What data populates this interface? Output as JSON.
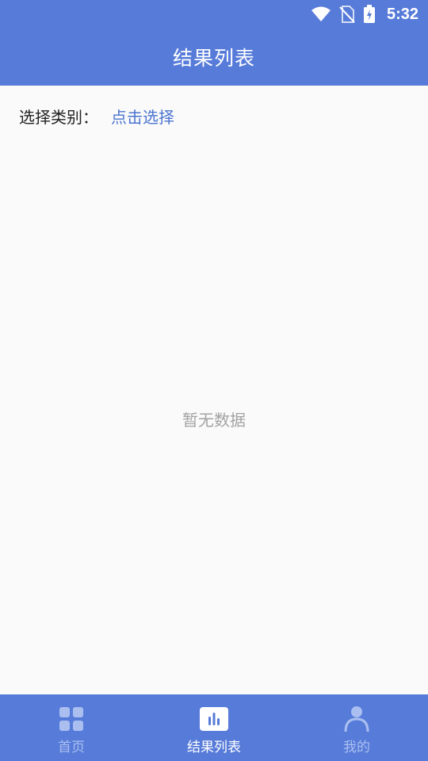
{
  "status_bar": {
    "time": "5:32",
    "icons": [
      "wifi-icon",
      "no-sim-icon",
      "battery-charging-icon"
    ]
  },
  "header": {
    "title": "结果列表"
  },
  "filter": {
    "label": "选择类别：",
    "value": "点击选择"
  },
  "empty_state": {
    "text": "暂无数据"
  },
  "bottom_nav": {
    "items": [
      {
        "label": "首页",
        "icon": "home-grid-icon",
        "active": false
      },
      {
        "label": "结果列表",
        "icon": "bar-chart-icon",
        "active": true
      },
      {
        "label": "我的",
        "icon": "person-icon",
        "active": false
      }
    ]
  },
  "colors": {
    "primary": "#577bd9",
    "link": "#4a74cf",
    "background": "#fafafa",
    "muted_text": "#a3a3a3",
    "nav_inactive": "#aabff0"
  }
}
